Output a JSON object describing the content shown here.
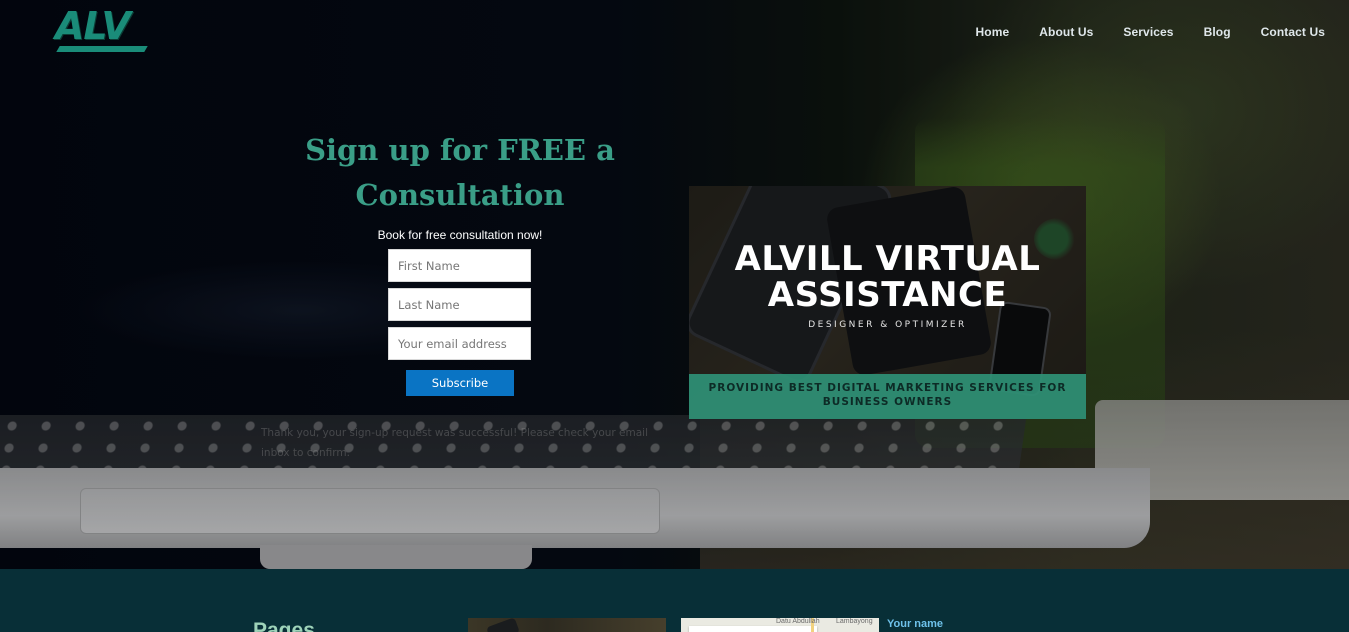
{
  "header": {
    "logo_text": "ALV",
    "nav": [
      {
        "label": "Home"
      },
      {
        "label": "About Us"
      },
      {
        "label": "Services"
      },
      {
        "label": "Blog"
      },
      {
        "label": "Contact Us"
      }
    ]
  },
  "signup": {
    "headline": "Sign up for FREE a Consultation",
    "subtitle": "Book for free consultation now!",
    "first_name_placeholder": "First Name",
    "last_name_placeholder": "Last Name",
    "email_placeholder": "Your email address",
    "button_label": "Subscribe",
    "success_message": "Thank you, your sign-up request was successful! Please check your email inbox to confirm."
  },
  "banner": {
    "title": "ALVILL VIRTUAL ASSISTANCE",
    "tagline": "DESIGNER & OPTIMIZER",
    "ribbon": "PROVIDING BEST DIGITAL MARKETING SERVICES FOR BUSINESS OWNERS"
  },
  "footer": {
    "pages_heading": "Pages",
    "map_labels": [
      "Datu Abdullah",
      "Lambayong"
    ],
    "form_label": "Your name"
  },
  "colors": {
    "accent": "#3a9e87",
    "button": "#0a74c4",
    "footer_bg": "#082f37",
    "link_blue": "#6ec2ea"
  }
}
